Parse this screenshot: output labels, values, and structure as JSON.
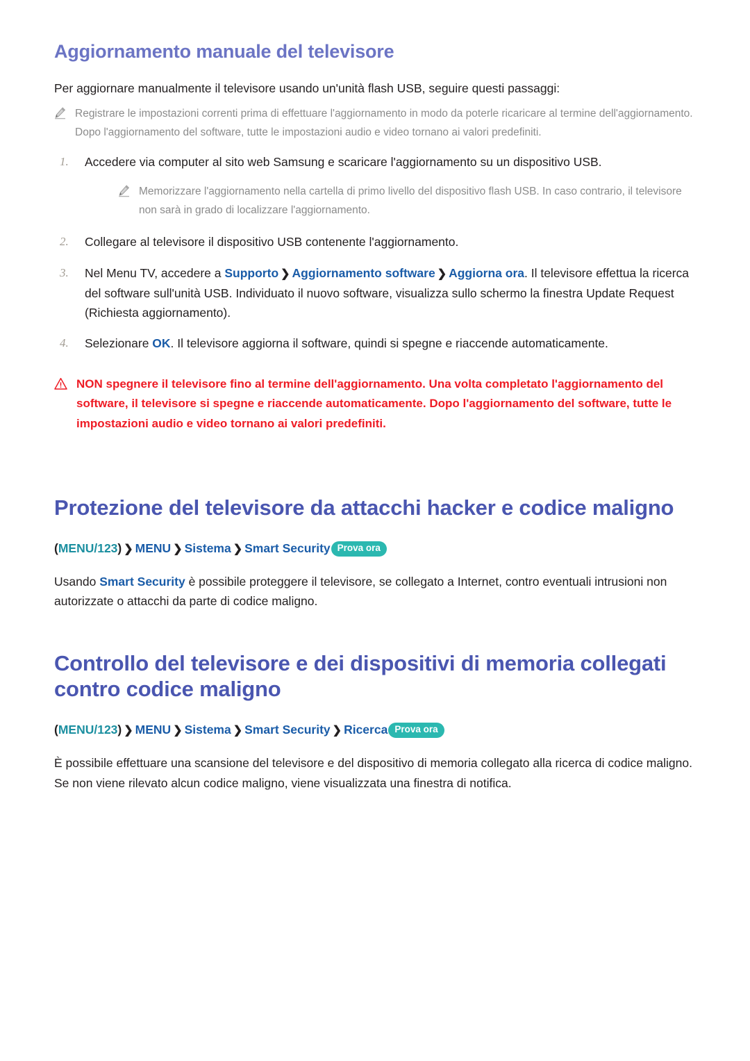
{
  "sections": {
    "manual_update": {
      "heading": "Aggiornamento manuale del televisore",
      "intro": "Per aggiornare manualmente il televisore usando un'unità flash USB, seguire questi passaggi:",
      "note_top": "Registrare le impostazioni correnti prima di effettuare l'aggiornamento in modo da poterle ricaricare al termine dell'aggiornamento. Dopo l'aggiornamento del software, tutte le impostazioni audio e video tornano ai valori predefiniti.",
      "steps": [
        {
          "number": "1.",
          "text": "Accedere via computer al sito web Samsung e scaricare l'aggiornamento su un dispositivo USB."
        },
        {
          "number": "2.",
          "text": "Collegare al televisore il dispositivo USB contenente l'aggiornamento."
        },
        {
          "number": "3.",
          "prefix": "Nel Menu TV, accedere a ",
          "link1": "Supporto",
          "link2": "Aggiornamento software",
          "link3": "Aggiorna ora",
          "suffix": ". Il televisore effettua la ricerca del software sull'unità USB. Individuato il nuovo software, visualizza sullo schermo la finestra Update Request (Richiesta aggiornamento)."
        },
        {
          "number": "4.",
          "prefix": "Selezionare ",
          "link1": "OK",
          "suffix": ". Il televisore aggiorna il software, quindi si spegne e riaccende automaticamente."
        }
      ],
      "note_step1": "Memorizzare l'aggiornamento nella cartella di primo livello del dispositivo flash USB. In caso contrario, il televisore non sarà in grado di localizzare l'aggiornamento.",
      "warning": "NON spegnere il televisore fino al termine dell'aggiornamento. Una volta completato l'aggiornamento del software, il televisore si spegne e riaccende automaticamente. Dopo l'aggiornamento del software, tutte le impostazioni audio e video tornano ai valori predefiniti."
    },
    "protection": {
      "heading": "Protezione del televisore da attacchi hacker e codice maligno",
      "breadcrumb": {
        "open_paren": "(",
        "menu123": "MENU/123",
        "close_paren": ")",
        "separator": "❯",
        "items": [
          "MENU",
          "Sistema",
          "Smart Security"
        ],
        "badge": "Prova ora"
      },
      "body_prefix": "Usando ",
      "body_link": "Smart Security",
      "body_suffix": " è possibile proteggere il televisore, se collegato a Internet, contro eventuali intrusioni non autorizzate o attacchi da parte di codice maligno."
    },
    "scan": {
      "heading": "Controllo del televisore e dei dispositivi di memoria collegati contro codice maligno",
      "breadcrumb": {
        "open_paren": "(",
        "menu123": "MENU/123",
        "close_paren": ")",
        "separator": "❯",
        "items": [
          "MENU",
          "Sistema",
          "Smart Security",
          "Ricerca"
        ],
        "badge": "Prova ora"
      },
      "body": "È possibile effettuare una scansione del televisore e del dispositivo di memoria collegato alla ricerca di codice maligno. Se non viene rilevato alcun codice maligno, viene visualizzata una finestra di notifica."
    }
  },
  "colors": {
    "heading_purple": "#6b74c4",
    "heading_indigo": "#4a56b0",
    "link_blue": "#1a5ca8",
    "teal": "#1b8fa0",
    "badge_teal": "#2bb8b0",
    "warning_red": "#ee1c25",
    "note_gray": "#8b8b8b",
    "number_gray": "#a39d94",
    "body_black": "#231f20"
  }
}
